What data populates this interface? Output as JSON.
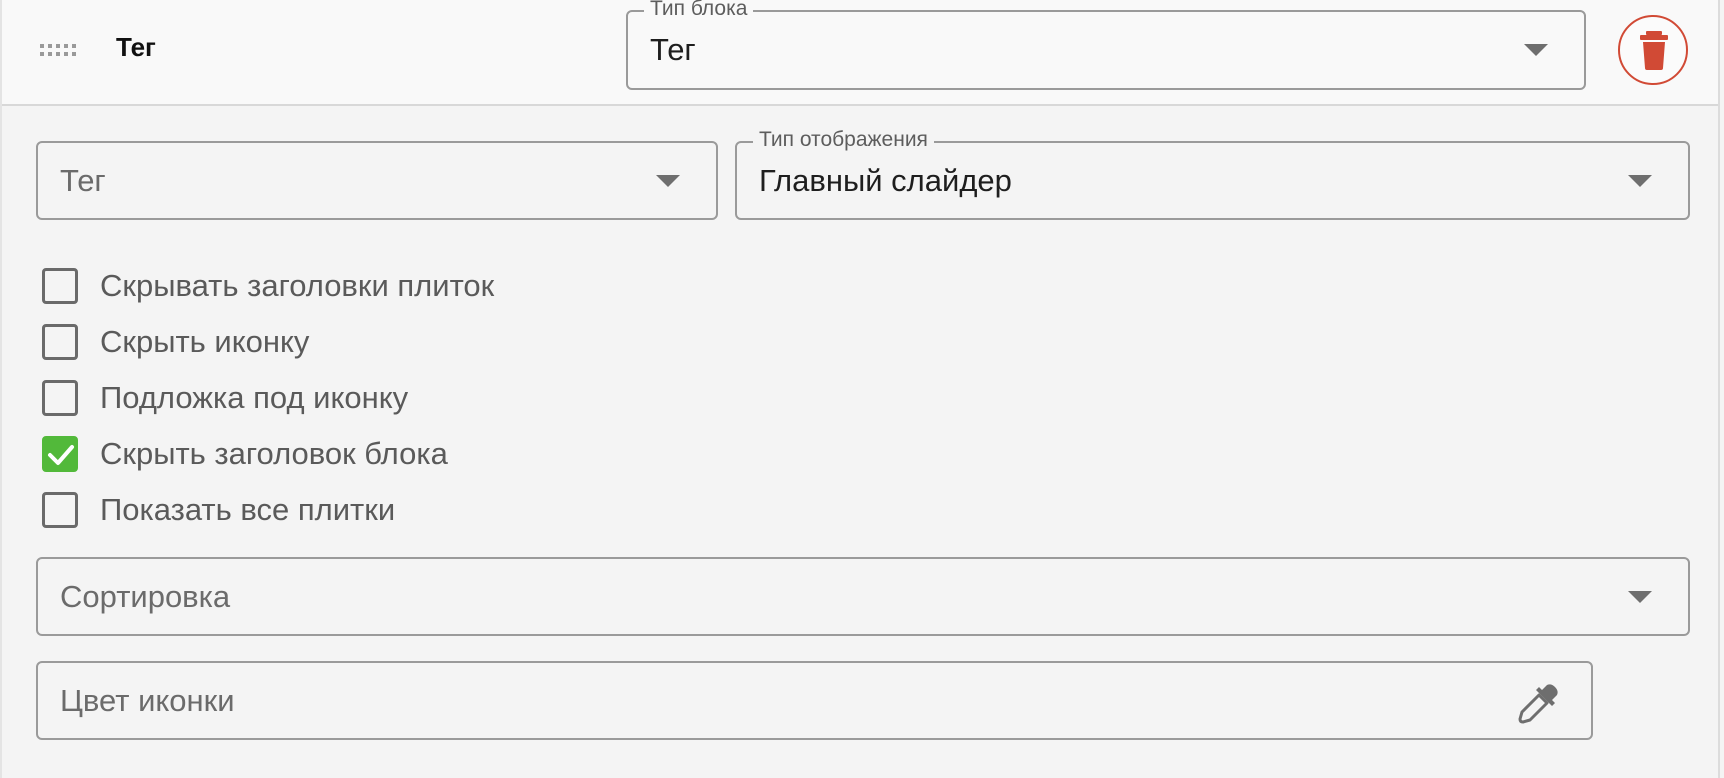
{
  "header": {
    "title": "Тег",
    "block_type": {
      "legend": "Тип блока",
      "value": "Тег"
    }
  },
  "fields": {
    "tag": {
      "placeholder": "Тег"
    },
    "display_type": {
      "legend": "Тип отображения",
      "value": "Главный слайдер"
    },
    "sort": {
      "placeholder": "Сортировка"
    },
    "icon_color": {
      "placeholder": "Цвет иконки"
    }
  },
  "checkboxes": [
    {
      "label": "Скрывать заголовки плиток",
      "checked": false
    },
    {
      "label": "Скрыть иконку",
      "checked": false
    },
    {
      "label": "Подложка под иконку",
      "checked": false
    },
    {
      "label": "Скрыть заголовок блока",
      "checked": true
    },
    {
      "label": "Показать все плитки",
      "checked": false
    }
  ],
  "icons": {
    "drag": "drag-handle-icon",
    "delete": "trash-icon",
    "dropdown": "chevron-down-icon",
    "picker": "eyedropper-icon"
  },
  "colors": {
    "delete_accent": "#d14a35",
    "checked_accent": "#52b93a"
  }
}
